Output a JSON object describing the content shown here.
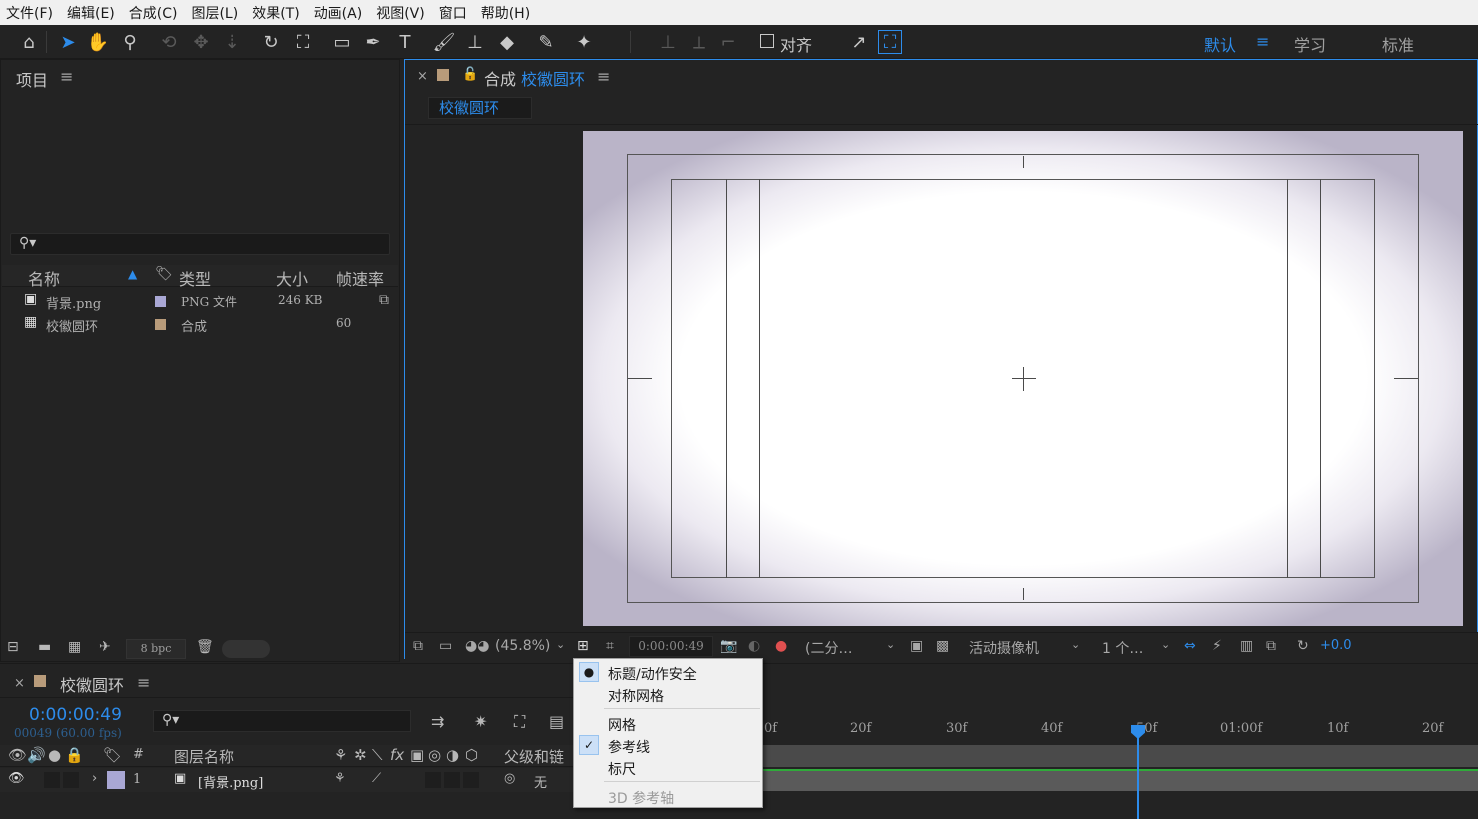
{
  "menubar": {
    "items": [
      "文件(F)",
      "编辑(E)",
      "合成(C)",
      "图层(L)",
      "效果(T)",
      "动画(A)",
      "视图(V)",
      "窗口",
      "帮助(H)"
    ]
  },
  "toolbar": {
    "align_label": "对齐",
    "workspaces": [
      "默认",
      "学习",
      "标准"
    ],
    "active_workspace": "默认"
  },
  "project": {
    "title": "项目",
    "columns": [
      "名称",
      "类型",
      "大小",
      "帧速率"
    ],
    "items": [
      {
        "name": "背景.png",
        "type": "PNG 文件",
        "size": "246 KB",
        "fps": "",
        "swatch": "#a9a7d4"
      },
      {
        "name": "校徽圆环",
        "type": "合成",
        "size": "",
        "fps": "60",
        "swatch": "#b89b7a"
      }
    ],
    "bpc": "8 bpc"
  },
  "comp": {
    "prefix": "合成",
    "name": "校徽圆环",
    "tab_label": "校徽圆环",
    "zoom": "(45.8%)",
    "timecode": "0:00:00:49",
    "resolution": "(二分…",
    "camera": "活动摄像机",
    "views": "1 个…",
    "exposure": "+0.0"
  },
  "timeline": {
    "tab": "校徽圆环",
    "timecode": "0:00:00:49",
    "fps_text": "00049 (60.00 fps)",
    "header": {
      "hash": "#",
      "layer_name": "图层名称",
      "parent": "父级和链"
    },
    "layer": {
      "index": "1",
      "name": "[背景.png]",
      "parent": "无",
      "label_color": "#a9a7d4"
    },
    "ruler": [
      "0f",
      "20f",
      "30f",
      "40f",
      "50f",
      "01:00f",
      "10f",
      "20f"
    ]
  },
  "dropdown": {
    "items": [
      {
        "label": "标题/动作安全",
        "mark": "dot"
      },
      {
        "label": "对称网格",
        "mark": ""
      },
      {
        "label": "网格",
        "mark": ""
      },
      {
        "label": "参考线",
        "mark": "check"
      },
      {
        "label": "标尺",
        "mark": ""
      },
      {
        "label": "3D 参考轴",
        "mark": "",
        "disabled": true
      }
    ]
  },
  "colors": {
    "accent": "#2d8ceb",
    "bg": "#232323",
    "timeline_green": "#2faa3a"
  }
}
